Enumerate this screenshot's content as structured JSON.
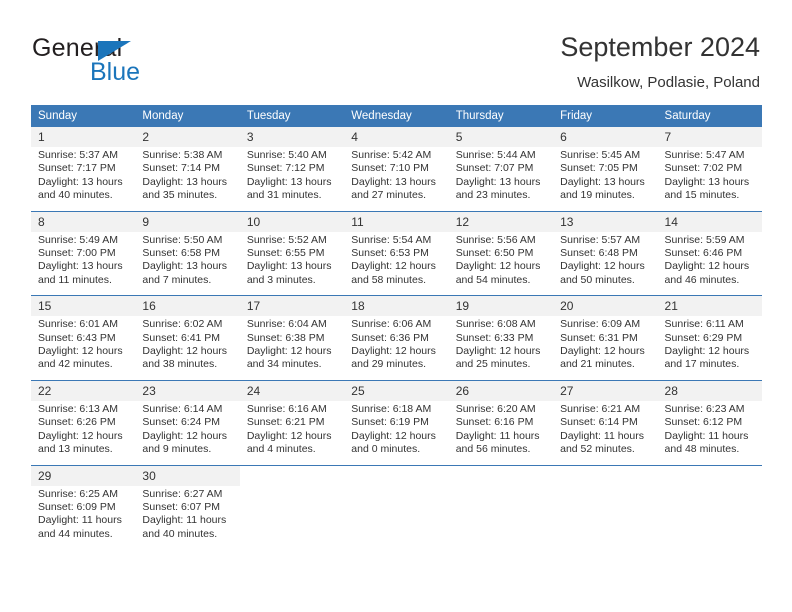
{
  "logo": {
    "word_top": "General",
    "word_bottom": "Blue",
    "triangle_icon": "triangle-icon",
    "brand_color": "#1b75bb",
    "text_color": "#231f20"
  },
  "header": {
    "title": "September 2024",
    "subtitle": "Wasilkow, Podlasie, Poland"
  },
  "theme": {
    "header_bg": "#3b78b5",
    "header_text": "#ffffff",
    "daynum_bg": "#f2f2f2",
    "body_text": "#333333"
  },
  "weekday_headers": [
    "Sunday",
    "Monday",
    "Tuesday",
    "Wednesday",
    "Thursday",
    "Friday",
    "Saturday"
  ],
  "weeks": [
    {
      "days": [
        {
          "date": "1",
          "sunrise": "Sunrise: 5:37 AM",
          "sunset": "Sunset: 7:17 PM",
          "daylight_line1": "Daylight: 13 hours",
          "daylight_line2": "and 40 minutes."
        },
        {
          "date": "2",
          "sunrise": "Sunrise: 5:38 AM",
          "sunset": "Sunset: 7:14 PM",
          "daylight_line1": "Daylight: 13 hours",
          "daylight_line2": "and 35 minutes."
        },
        {
          "date": "3",
          "sunrise": "Sunrise: 5:40 AM",
          "sunset": "Sunset: 7:12 PM",
          "daylight_line1": "Daylight: 13 hours",
          "daylight_line2": "and 31 minutes."
        },
        {
          "date": "4",
          "sunrise": "Sunrise: 5:42 AM",
          "sunset": "Sunset: 7:10 PM",
          "daylight_line1": "Daylight: 13 hours",
          "daylight_line2": "and 27 minutes."
        },
        {
          "date": "5",
          "sunrise": "Sunrise: 5:44 AM",
          "sunset": "Sunset: 7:07 PM",
          "daylight_line1": "Daylight: 13 hours",
          "daylight_line2": "and 23 minutes."
        },
        {
          "date": "6",
          "sunrise": "Sunrise: 5:45 AM",
          "sunset": "Sunset: 7:05 PM",
          "daylight_line1": "Daylight: 13 hours",
          "daylight_line2": "and 19 minutes."
        },
        {
          "date": "7",
          "sunrise": "Sunrise: 5:47 AM",
          "sunset": "Sunset: 7:02 PM",
          "daylight_line1": "Daylight: 13 hours",
          "daylight_line2": "and 15 minutes."
        }
      ]
    },
    {
      "days": [
        {
          "date": "8",
          "sunrise": "Sunrise: 5:49 AM",
          "sunset": "Sunset: 7:00 PM",
          "daylight_line1": "Daylight: 13 hours",
          "daylight_line2": "and 11 minutes."
        },
        {
          "date": "9",
          "sunrise": "Sunrise: 5:50 AM",
          "sunset": "Sunset: 6:58 PM",
          "daylight_line1": "Daylight: 13 hours",
          "daylight_line2": "and 7 minutes."
        },
        {
          "date": "10",
          "sunrise": "Sunrise: 5:52 AM",
          "sunset": "Sunset: 6:55 PM",
          "daylight_line1": "Daylight: 13 hours",
          "daylight_line2": "and 3 minutes."
        },
        {
          "date": "11",
          "sunrise": "Sunrise: 5:54 AM",
          "sunset": "Sunset: 6:53 PM",
          "daylight_line1": "Daylight: 12 hours",
          "daylight_line2": "and 58 minutes."
        },
        {
          "date": "12",
          "sunrise": "Sunrise: 5:56 AM",
          "sunset": "Sunset: 6:50 PM",
          "daylight_line1": "Daylight: 12 hours",
          "daylight_line2": "and 54 minutes."
        },
        {
          "date": "13",
          "sunrise": "Sunrise: 5:57 AM",
          "sunset": "Sunset: 6:48 PM",
          "daylight_line1": "Daylight: 12 hours",
          "daylight_line2": "and 50 minutes."
        },
        {
          "date": "14",
          "sunrise": "Sunrise: 5:59 AM",
          "sunset": "Sunset: 6:46 PM",
          "daylight_line1": "Daylight: 12 hours",
          "daylight_line2": "and 46 minutes."
        }
      ]
    },
    {
      "days": [
        {
          "date": "15",
          "sunrise": "Sunrise: 6:01 AM",
          "sunset": "Sunset: 6:43 PM",
          "daylight_line1": "Daylight: 12 hours",
          "daylight_line2": "and 42 minutes."
        },
        {
          "date": "16",
          "sunrise": "Sunrise: 6:02 AM",
          "sunset": "Sunset: 6:41 PM",
          "daylight_line1": "Daylight: 12 hours",
          "daylight_line2": "and 38 minutes."
        },
        {
          "date": "17",
          "sunrise": "Sunrise: 6:04 AM",
          "sunset": "Sunset: 6:38 PM",
          "daylight_line1": "Daylight: 12 hours",
          "daylight_line2": "and 34 minutes."
        },
        {
          "date": "18",
          "sunrise": "Sunrise: 6:06 AM",
          "sunset": "Sunset: 6:36 PM",
          "daylight_line1": "Daylight: 12 hours",
          "daylight_line2": "and 29 minutes."
        },
        {
          "date": "19",
          "sunrise": "Sunrise: 6:08 AM",
          "sunset": "Sunset: 6:33 PM",
          "daylight_line1": "Daylight: 12 hours",
          "daylight_line2": "and 25 minutes."
        },
        {
          "date": "20",
          "sunrise": "Sunrise: 6:09 AM",
          "sunset": "Sunset: 6:31 PM",
          "daylight_line1": "Daylight: 12 hours",
          "daylight_line2": "and 21 minutes."
        },
        {
          "date": "21",
          "sunrise": "Sunrise: 6:11 AM",
          "sunset": "Sunset: 6:29 PM",
          "daylight_line1": "Daylight: 12 hours",
          "daylight_line2": "and 17 minutes."
        }
      ]
    },
    {
      "days": [
        {
          "date": "22",
          "sunrise": "Sunrise: 6:13 AM",
          "sunset": "Sunset: 6:26 PM",
          "daylight_line1": "Daylight: 12 hours",
          "daylight_line2": "and 13 minutes."
        },
        {
          "date": "23",
          "sunrise": "Sunrise: 6:14 AM",
          "sunset": "Sunset: 6:24 PM",
          "daylight_line1": "Daylight: 12 hours",
          "daylight_line2": "and 9 minutes."
        },
        {
          "date": "24",
          "sunrise": "Sunrise: 6:16 AM",
          "sunset": "Sunset: 6:21 PM",
          "daylight_line1": "Daylight: 12 hours",
          "daylight_line2": "and 4 minutes."
        },
        {
          "date": "25",
          "sunrise": "Sunrise: 6:18 AM",
          "sunset": "Sunset: 6:19 PM",
          "daylight_line1": "Daylight: 12 hours",
          "daylight_line2": "and 0 minutes."
        },
        {
          "date": "26",
          "sunrise": "Sunrise: 6:20 AM",
          "sunset": "Sunset: 6:16 PM",
          "daylight_line1": "Daylight: 11 hours",
          "daylight_line2": "and 56 minutes."
        },
        {
          "date": "27",
          "sunrise": "Sunrise: 6:21 AM",
          "sunset": "Sunset: 6:14 PM",
          "daylight_line1": "Daylight: 11 hours",
          "daylight_line2": "and 52 minutes."
        },
        {
          "date": "28",
          "sunrise": "Sunrise: 6:23 AM",
          "sunset": "Sunset: 6:12 PM",
          "daylight_line1": "Daylight: 11 hours",
          "daylight_line2": "and 48 minutes."
        }
      ]
    },
    {
      "days": [
        {
          "date": "29",
          "sunrise": "Sunrise: 6:25 AM",
          "sunset": "Sunset: 6:09 PM",
          "daylight_line1": "Daylight: 11 hours",
          "daylight_line2": "and 44 minutes."
        },
        {
          "date": "30",
          "sunrise": "Sunrise: 6:27 AM",
          "sunset": "Sunset: 6:07 PM",
          "daylight_line1": "Daylight: 11 hours",
          "daylight_line2": "and 40 minutes."
        },
        {
          "date": "",
          "sunrise": "",
          "sunset": "",
          "daylight_line1": "",
          "daylight_line2": ""
        },
        {
          "date": "",
          "sunrise": "",
          "sunset": "",
          "daylight_line1": "",
          "daylight_line2": ""
        },
        {
          "date": "",
          "sunrise": "",
          "sunset": "",
          "daylight_line1": "",
          "daylight_line2": ""
        },
        {
          "date": "",
          "sunrise": "",
          "sunset": "",
          "daylight_line1": "",
          "daylight_line2": ""
        },
        {
          "date": "",
          "sunrise": "",
          "sunset": "",
          "daylight_line1": "",
          "daylight_line2": ""
        }
      ]
    }
  ]
}
